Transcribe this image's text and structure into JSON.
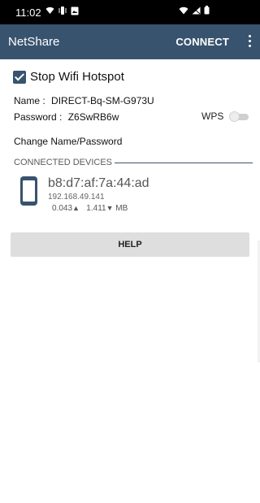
{
  "status_bar": {
    "time": "11:02"
  },
  "app_bar": {
    "title": "NetShare",
    "connect_label": "CONNECT"
  },
  "hotspot": {
    "checked": true,
    "label": "Stop Wifi Hotspot"
  },
  "network": {
    "name_label": "Name :",
    "name_value": "DIRECT-Bq-SM-G973U",
    "password_label": "Password :",
    "password_value": "Z6SwRB6w",
    "wps_label": "WPS",
    "wps_enabled": false
  },
  "change_label": "Change Name/Password",
  "devices": {
    "header": "CONNECTED DEVICES",
    "items": [
      {
        "mac": "b8:d7:af:7a:44:ad",
        "ip": "192.168.49.141",
        "upload": "0.043",
        "download": "1.411",
        "unit": "MB"
      }
    ]
  },
  "help_label": "HELP",
  "colors": {
    "app_bar": "#38536e",
    "accent": "#38536e",
    "button_bg": "#dedede"
  }
}
